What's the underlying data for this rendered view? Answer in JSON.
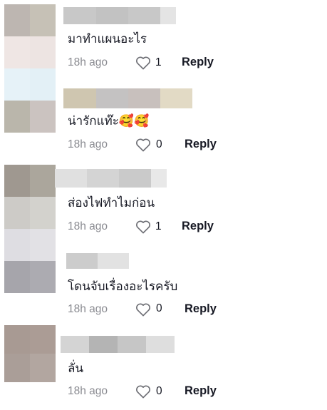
{
  "comments": [
    {
      "text": "มาทำแผนอะไร",
      "time": "18h ago",
      "likes": "1",
      "reply_label": "Reply"
    },
    {
      "text": "น่ารักแท๊ะ🥰🥰",
      "time": "18h ago",
      "likes": "0",
      "reply_label": "Reply"
    },
    {
      "text": "ส่องไฟทำไมก่อน",
      "time": "18h ago",
      "likes": "1",
      "reply_label": "Reply"
    },
    {
      "text": "โดนจับเรื่องอะไรครับ",
      "time": "18h ago",
      "likes": "0",
      "reply_label": "Reply"
    },
    {
      "text": "ลั่น",
      "time": "18h ago",
      "likes": "0",
      "reply_label": "Reply"
    }
  ],
  "colors": {
    "text": "#161823",
    "meta": "#8a8b91",
    "heart_outline": "#6e6f75"
  },
  "icons": {
    "like": "heart-outline-icon"
  }
}
